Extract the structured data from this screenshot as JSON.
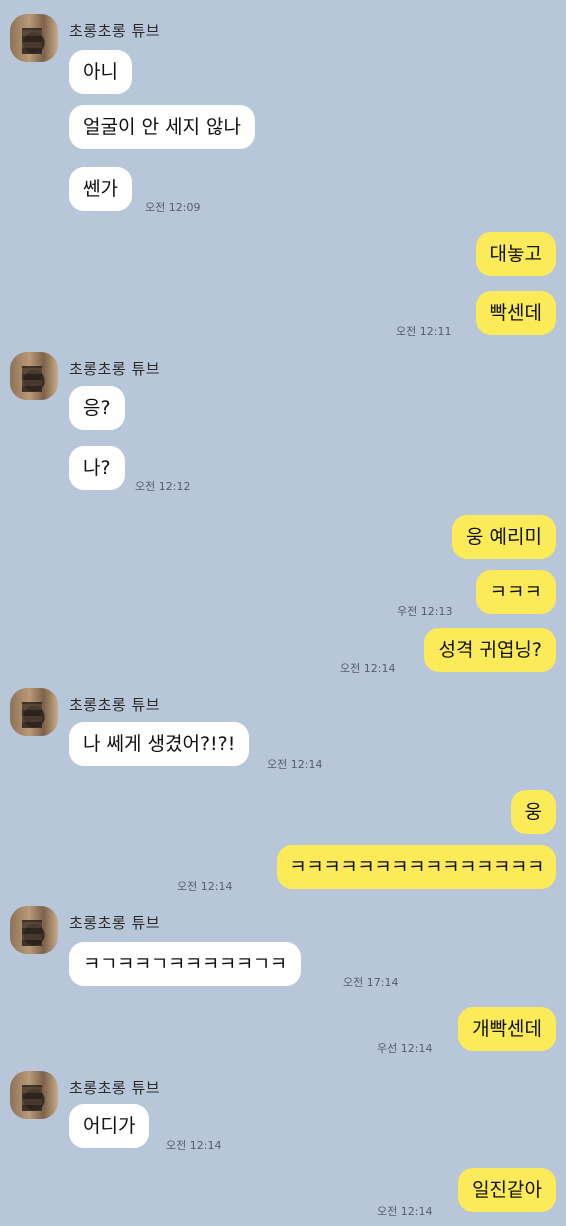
{
  "sender_name": "초롱초롱 튜브",
  "messages": {
    "m1": "아니",
    "m2": "얼굴이 안 세지 않나",
    "m3": "쎈가",
    "t3": "오전 12:09",
    "m4": "대놓고",
    "m5": "빡센데",
    "t5": "오전 12:11",
    "m6": "응?",
    "m7": "나?",
    "t7": "오전 12:12",
    "m8": "웅 예리미",
    "m9": "ㅋㅋㅋ",
    "t9": "우전 12:13",
    "m10": "성격 귀엽닝?",
    "t10": "오전 12:14",
    "m11": "나 쎄게 생겼어?!?!",
    "t11": "오전 12:14",
    "m12": "웅",
    "m13": "ㅋㅋㅋㅋㅋㅋㅋㅋㅋㅋㅋㅋㅋㅋㅋ",
    "t13": "오전 12:14",
    "m14": "ㅋㄱㅋㅋㄱㅋㅋㅋㅋㅋㄱㅋ",
    "t14": "오전 17:14",
    "m15": "개빡센데",
    "t15": "우선 12:14",
    "m16": "어디가",
    "t16": "오전 12:14",
    "m17": "일진같아",
    "t17": "오전 12:14"
  }
}
